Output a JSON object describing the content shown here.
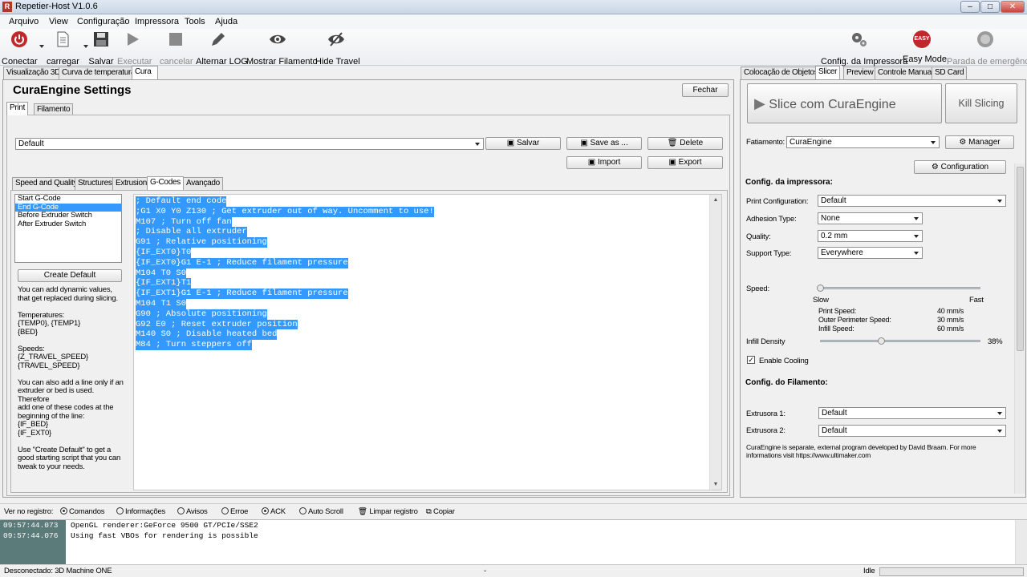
{
  "window": {
    "title": "Repetier-Host V1.0.6",
    "app_icon": "R"
  },
  "menu": [
    "Arquivo",
    "View",
    "Configuração",
    "Impressora",
    "Tools",
    "Ajuda"
  ],
  "toolbar": {
    "connect": "Conectar",
    "load": "carregar",
    "save": "Salvar",
    "run": "Executar",
    "cancel": "cancelar",
    "log": "Alternar LOG",
    "show_filament": "Mostrar Filamento",
    "hide_travel": "Hide Travel",
    "printer_config": "Config. da Impressora",
    "easy_mode": "Easy Mode",
    "easy_badge": "EASY",
    "emergency": "Parada de emergência"
  },
  "left_tabs": [
    "Visualização 3D",
    "Curva de temperatura",
    "Cura"
  ],
  "cura": {
    "title": "CuraEngine Settings",
    "close": "Fechar",
    "subtabs": [
      "Print",
      "Filamento"
    ],
    "profile": "Default",
    "buttons": {
      "save": "Salvar",
      "save_as": "Save as ...",
      "delete": "Delete",
      "import": "Import",
      "export": "Export"
    },
    "section_tabs": [
      "Speed and Quality",
      "Structures",
      "Extrusion",
      "G-Codes",
      "Avançado"
    ],
    "gcode_list": [
      "Start G-Code",
      "End G-Code",
      "Before Extruder Switch",
      "After Extruder Switch"
    ],
    "create_default": "Create Default",
    "help": [
      "You can add dynamic values,",
      "that get replaced during slicing.",
      "",
      "Temperatures:",
      "{TEMP0}, {TEMP1}",
      "{BED}",
      "",
      "Speeds:",
      "{Z_TRAVEL_SPEED}",
      "{TRAVEL_SPEED}",
      "",
      "You can also add a line only if an",
      "extruder or bed is used. Therefore",
      "add one of these codes at the",
      "beginning of the line:",
      "{IF_BED}",
      "{IF_EXT0}",
      "",
      "Use \"Create Default\" to get a",
      "good starting script that you can",
      "tweak to your needs."
    ],
    "gcode_lines": [
      "; Default end code",
      ";G1 X0 Y0 Z130 ; Get extruder out of way. Uncomment to use!",
      "M107 ; Turn off fan",
      "; Disable all extruder",
      "G91 ; Relative positioning",
      "{IF_EXT0}T0",
      "{IF_EXT0}G1 E-1 ; Reduce filament pressure",
      "M104 T0 S0",
      "{IF_EXT1}T1",
      "{IF_EXT1}G1 E-1 ; Reduce filament pressure",
      "M104 T1 S0",
      "G90 ; Absolute positioning",
      "G92 E0 ; Reset extruder position",
      "M140 S0 ; Disable heated bed",
      "M84 ; Turn steppers off"
    ]
  },
  "right_tabs": [
    "Colocação de Objetos",
    "Slicer",
    "Preview",
    "Controle Manual",
    "SD Card"
  ],
  "slicer": {
    "slice_button": "Slice com CuraEngine",
    "kill_button": "Kill Slicing",
    "fatiamento_label": "Fatiamento:",
    "fatiamento_value": "CuraEngine",
    "manager": "Manager",
    "configuration": "Configuration",
    "printer_section": "Config. da impressora:",
    "print_config_label": "Print Configuration:",
    "print_config_value": "Default",
    "adhesion_label": "Adhesion Type:",
    "adhesion_value": "None",
    "quality_label": "Quality:",
    "quality_value": "0.2 mm",
    "support_label": "Support Type:",
    "support_value": "Everywhere",
    "speed_label": "Speed:",
    "speed_level": 0.0,
    "slow": "Slow",
    "fast": "Fast",
    "print_speed_label": "Print Speed:",
    "print_speed_value": "40 mm/s",
    "outer_speed_label": "Outer Perimeter Speed:",
    "outer_speed_value": "30 mm/s",
    "infill_speed_label": "Infill Speed:",
    "infill_speed_value": "60 mm/s",
    "infill_label": "Infill Density",
    "infill_value": "38%",
    "infill_level": 0.38,
    "cooling_label": "Enable Cooling",
    "filament_section": "Config. do Filamento:",
    "ext1_label": "Extrusora 1:",
    "ext1_value": "Default",
    "ext2_label": "Extrusora 2:",
    "ext2_value": "Default",
    "note": "CuraEngine is separate, external program developed by David Braam. For more informations visit https://www.ultimaker.com"
  },
  "log": {
    "label": "Ver no registro:",
    "filters": [
      "Comandos",
      "Informações",
      "Avisos",
      "Erroe",
      "ACK",
      "Auto Scroll"
    ],
    "clear": "Limpar registro",
    "copy": "Copiar",
    "entries": [
      {
        "time": "09:57:44.073",
        "text": "OpenGL renderer:GeForce 9500 GT/PCIe/SSE2"
      },
      {
        "time": "09:57:44.076",
        "text": "Using fast VBOs for rendering is possible"
      }
    ]
  },
  "status": {
    "connection": "Desconectado: 3D Machine ONE",
    "center": "-",
    "state": "Idle"
  },
  "colors": {
    "selection": "#3399ff",
    "easy_red": "#c0282b"
  }
}
